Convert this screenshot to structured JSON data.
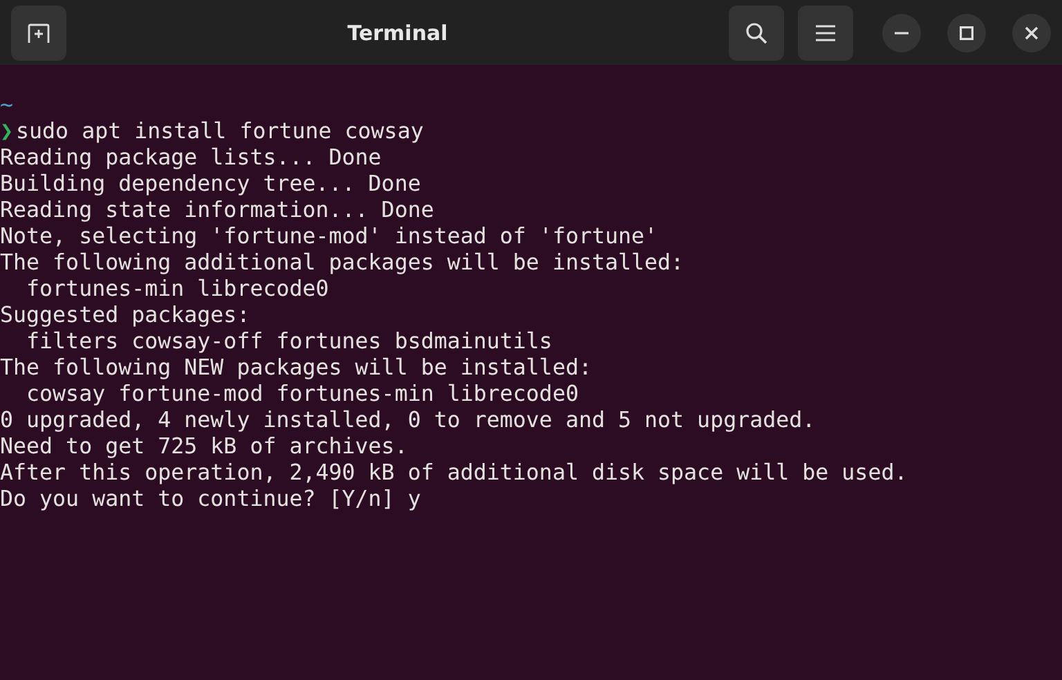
{
  "window": {
    "title": "Terminal"
  },
  "terminal": {
    "cwd": "~",
    "prompt_symbol": "❯",
    "command": "sudo apt install fortune cowsay",
    "output": [
      "Reading package lists... Done",
      "Building dependency tree... Done",
      "Reading state information... Done",
      "Note, selecting 'fortune-mod' instead of 'fortune'",
      "The following additional packages will be installed:",
      "  fortunes-min librecode0",
      "Suggested packages:",
      "  filters cowsay-off fortunes bsdmainutils",
      "The following NEW packages will be installed:",
      "  cowsay fortune-mod fortunes-min librecode0",
      "0 upgraded, 4 newly installed, 0 to remove and 5 not upgraded.",
      "Need to get 725 kB of archives.",
      "After this operation, 2,490 kB of additional disk space will be used.",
      "Do you want to continue? [Y/n] y"
    ]
  }
}
